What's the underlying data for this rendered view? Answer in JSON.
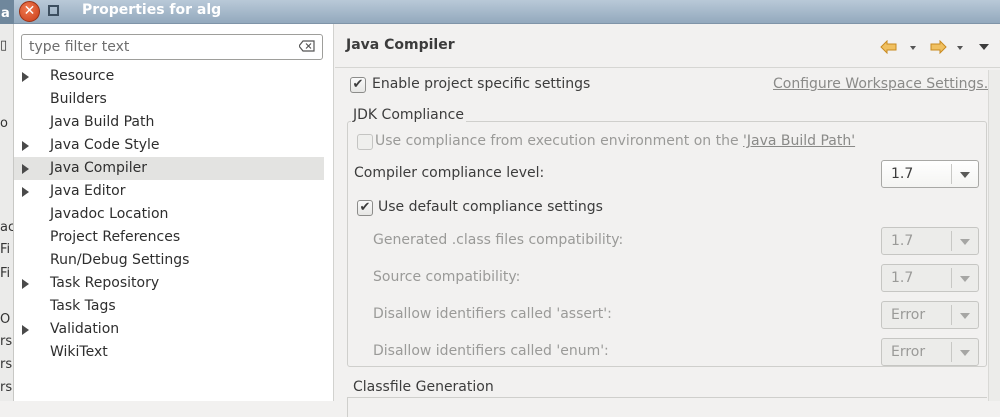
{
  "window": {
    "title": "Properties for alg",
    "close_glyph": "✕"
  },
  "background_window": {
    "edge_texts": [
      "a",
      "ac",
      "Fi",
      "Fi",
      "O",
      "rs",
      "rs",
      "rs"
    ]
  },
  "filter": {
    "placeholder": "type filter text"
  },
  "tree": {
    "items": [
      {
        "label": "Resource",
        "expandable": true,
        "selected": false
      },
      {
        "label": "Builders",
        "expandable": false,
        "selected": false
      },
      {
        "label": "Java Build Path",
        "expandable": false,
        "selected": false
      },
      {
        "label": "Java Code Style",
        "expandable": true,
        "selected": false
      },
      {
        "label": "Java Compiler",
        "expandable": true,
        "selected": true
      },
      {
        "label": "Java Editor",
        "expandable": true,
        "selected": false
      },
      {
        "label": "Javadoc Location",
        "expandable": false,
        "selected": false
      },
      {
        "label": "Project References",
        "expandable": false,
        "selected": false
      },
      {
        "label": "Run/Debug Settings",
        "expandable": false,
        "selected": false
      },
      {
        "label": "Task Repository",
        "expandable": true,
        "selected": false
      },
      {
        "label": "Task Tags",
        "expandable": false,
        "selected": false
      },
      {
        "label": "Validation",
        "expandable": true,
        "selected": false
      },
      {
        "label": "WikiText",
        "expandable": false,
        "selected": false
      }
    ]
  },
  "page": {
    "title": "Java Compiler",
    "enable_specific": {
      "label": "Enable project specific settings",
      "checked": true
    },
    "configure_link": "Configure Workspace Settings...",
    "jdk_group_title": "JDK Compliance",
    "use_env": {
      "label_prefix": "Use compliance from execution environment on the ",
      "link": "'Java Build Path'",
      "checked": false,
      "enabled": false
    },
    "compliance_level": {
      "label": "Compiler compliance level:",
      "value": "1.7"
    },
    "use_default": {
      "label": "Use default compliance settings",
      "checked": true
    },
    "generated_class": {
      "label": "Generated .class files compatibility:",
      "value": "1.7"
    },
    "source_compat": {
      "label": "Source compatibility:",
      "value": "1.7"
    },
    "disallow_assert": {
      "label": "Disallow identifiers called 'assert':",
      "value": "Error"
    },
    "disallow_enum": {
      "label": "Disallow identifiers called 'enum':",
      "value": "Error"
    },
    "classfile_group_title": "Classfile Generation"
  },
  "colors": {
    "title_bar": "#93a9bd",
    "close_button": "#d9532b",
    "nav_arrow": "#e8a030",
    "selected_row": "#e3e3e1"
  }
}
